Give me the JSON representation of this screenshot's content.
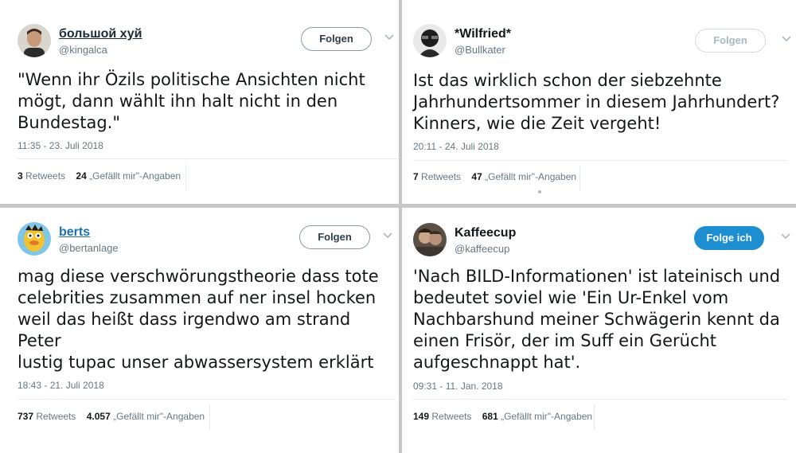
{
  "tweets": [
    {
      "name": "большой хуй",
      "handle": "@kingalca",
      "follow_label": "Folgen",
      "lines": [
        "\"Wenn ihr Özils politische Ansichten nicht",
        "mögt, dann wählt ihn halt nicht in den",
        "Bundestag.\""
      ],
      "timestamp": "11:35 - 23. Juli 2018",
      "retweets": "3",
      "retweets_label": "Retweets",
      "likes": "24",
      "likes_label": "„Gefällt mir\"-Angaben"
    },
    {
      "name": "*Wilfried*",
      "handle": "@Bullkater",
      "follow_label": "Folgen",
      "lines": [
        "Ist das wirklich schon der siebzehnte",
        "Jahrhundertsommer in diesem Jahrhundert?",
        "Kinners, wie die Zeit vergeht!"
      ],
      "timestamp": "20:11 - 24. Juli 2018",
      "retweets": "7",
      "retweets_label": "Retweets",
      "likes": "47",
      "likes_label": "„Gefällt mir\"-Angaben"
    },
    {
      "name": "berts",
      "handle": "@bertanlage",
      "follow_label": "Folgen",
      "lines": [
        "mag diese verschwörungstheorie dass tote",
        "celebrities zusammen auf ner insel hocken",
        "weil das heißt dass irgendwo am strand Peter",
        "lustig tupac unser abwassersystem erklärt"
      ],
      "timestamp": "18:43 - 21. Juli 2018",
      "retweets": "737",
      "retweets_label": "Retweets",
      "likes": "4.057",
      "likes_label": "„Gefällt mir\"-Angaben"
    },
    {
      "name": "Kaffeecup",
      "handle": "@kaffeecup",
      "follow_label": "Folge ich",
      "lines": [
        "'Nach BILD-Informationen' ist lateinisch und",
        "bedeutet soviel wie 'Ein Ur-Enkel vom",
        "Nachbarshund meiner Schwägerin kennt da",
        "einen Frisör, der im Suff ein Gerücht",
        "aufgeschnappt hat'."
      ],
      "timestamp": "09:31 - 11. Jan. 2018",
      "retweets": "149",
      "retweets_label": "Retweets",
      "likes": "681",
      "likes_label": "„Gefällt mir\"-Angaben"
    }
  ],
  "colors": {
    "accent": "#1d8fd1",
    "text": "#14171a",
    "secondary": "#657786"
  },
  "icons": [
    "avatar",
    "chevron-down-icon"
  ]
}
